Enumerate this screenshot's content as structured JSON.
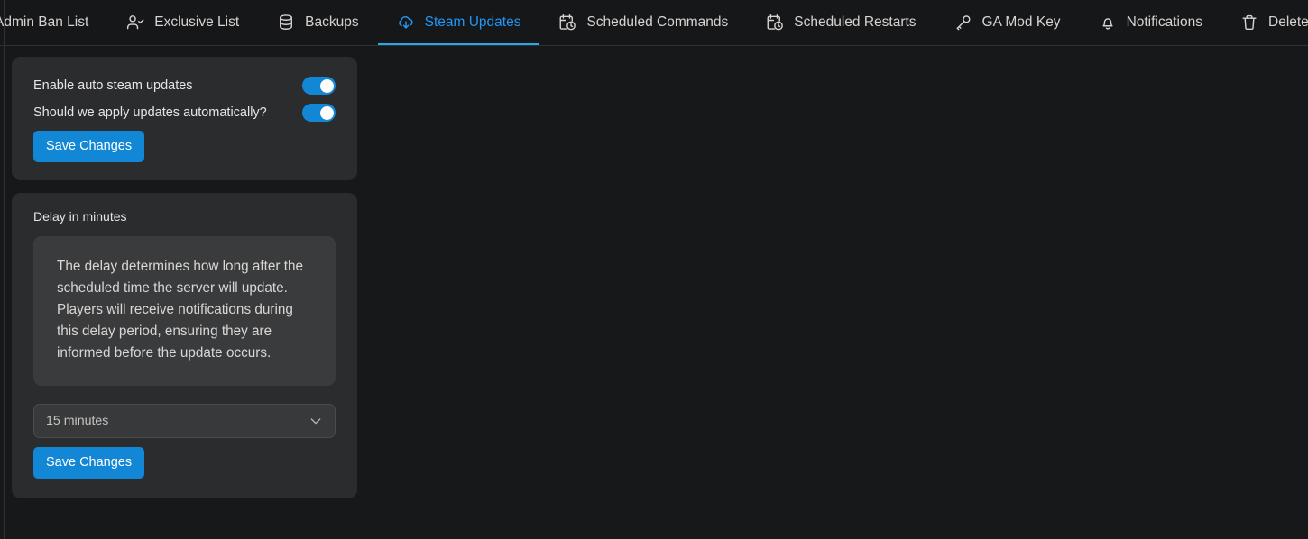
{
  "nav": {
    "tabs": [
      {
        "label": "Admin Ban List",
        "icon": "",
        "active": false
      },
      {
        "label": "Exclusive List",
        "icon": "user-check-icon",
        "active": false
      },
      {
        "label": "Backups",
        "icon": "database-icon",
        "active": false
      },
      {
        "label": "Steam Updates",
        "icon": "cloud-download-icon",
        "active": true
      },
      {
        "label": "Scheduled Commands",
        "icon": "calendar-clock-icon",
        "active": false
      },
      {
        "label": "Scheduled Restarts",
        "icon": "calendar-clock-icon",
        "active": false
      },
      {
        "label": "GA Mod Key",
        "icon": "key-icon",
        "active": false
      },
      {
        "label": "Notifications",
        "icon": "bell-icon",
        "active": false
      },
      {
        "label": "Delete Container",
        "icon": "trash-icon",
        "active": false
      }
    ]
  },
  "settings_card": {
    "toggles": [
      {
        "label": "Enable auto steam updates",
        "state": "on"
      },
      {
        "label": "Should we apply updates automatically?",
        "state": "on"
      }
    ],
    "save_label": "Save Changes"
  },
  "delay_card": {
    "field_label": "Delay in minutes",
    "description": "The delay determines how long after the scheduled time the server will update. Players will receive notifications during this delay period, ensuring they are informed before the update occurs.",
    "select_value": "15 minutes",
    "select_options": [
      "15 minutes"
    ],
    "chevron_icon": "chevron-down-icon",
    "save_label": "Save Changes"
  },
  "colors": {
    "page_bg": "#17181a",
    "card_bg": "#2b2c2e",
    "inner_box_bg": "#3a3b3d",
    "accent": "#1187d6",
    "active_tab": "#2196f3",
    "text": "#e7e5e4"
  }
}
